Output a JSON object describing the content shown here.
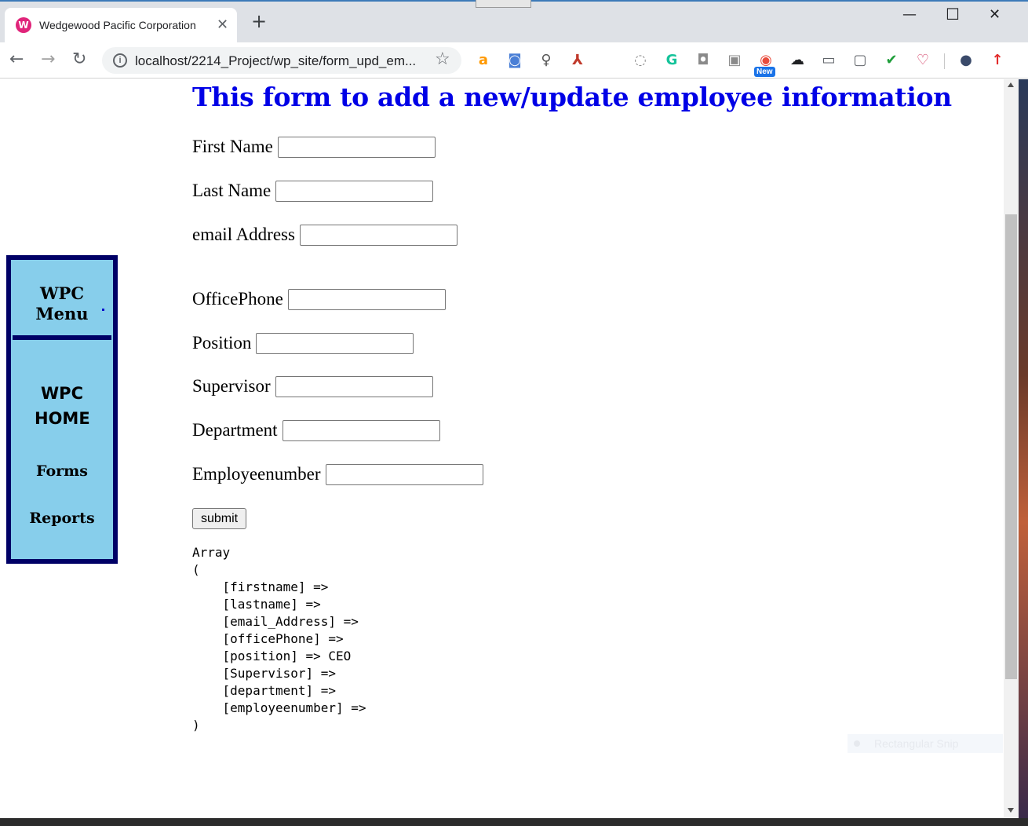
{
  "browser": {
    "tab_title": "Wedgewood Pacific Corporation",
    "tab_favicon": "W",
    "tab_close": "✕",
    "new_tab": "+",
    "url": "localhost/2214_Project/wp_site/form_upd_em...",
    "omnibox_info": "i",
    "bookmark_star": "☆",
    "nav_back": "←",
    "nav_forward": "→",
    "nav_reload": "↻",
    "window_minimize": "—",
    "window_maximize": "☐",
    "window_close": "✕",
    "extension_new_badge": "New",
    "extensions": [
      {
        "icon": "amazon-icon",
        "glyph": "a",
        "color": "#ff9900"
      },
      {
        "icon": "camera-icon",
        "glyph": "◙",
        "color": "#4a7fd6"
      },
      {
        "icon": "lightbulb-icon",
        "glyph": "♀",
        "color": "#555555"
      },
      {
        "icon": "acrobat-icon",
        "glyph": "⅄",
        "color": "#c0392b"
      },
      {
        "icon": "ellipsis-circle-icon",
        "glyph": "◌",
        "color": "#8a8a8a"
      },
      {
        "icon": "grammarly-icon",
        "glyph": "G",
        "color": "#15c39a"
      },
      {
        "icon": "screenshot-camera-icon",
        "glyph": "◘",
        "color": "#8a8a8a"
      },
      {
        "icon": "puzzle-icon",
        "glyph": "▣",
        "color": "#8a8a8a"
      },
      {
        "icon": "colorful-extension-icon",
        "glyph": "◉",
        "color": "#e84c3d"
      },
      {
        "icon": "cloud-icon",
        "glyph": "☁",
        "color": "#202124"
      },
      {
        "icon": "cast-icon",
        "glyph": "▭",
        "color": "#5f6368"
      },
      {
        "icon": "capture-frame-icon",
        "glyph": "▢",
        "color": "#5f6368"
      },
      {
        "icon": "checkmark-icon",
        "glyph": "✔",
        "color": "#1e9e3a"
      },
      {
        "icon": "pocket-icon",
        "glyph": "♡",
        "color": "#d0315a"
      },
      {
        "icon": "profile-avatar-icon",
        "glyph": "●",
        "color": "#3a4a6a"
      },
      {
        "icon": "update-arrow-icon",
        "glyph": "↑",
        "color": "#e22b2b"
      }
    ]
  },
  "sidenav": {
    "title": "WPC Menu",
    "home": "WPC HOME",
    "forms": "Forms",
    "reports": "Reports"
  },
  "form": {
    "heading": "This form to add a new/update employee information",
    "fields": [
      {
        "label": "First Name",
        "value": ""
      },
      {
        "label": "Last Name",
        "value": ""
      },
      {
        "label": "email Address",
        "value": ""
      },
      {
        "label": "OfficePhone",
        "value": ""
      },
      {
        "label": "Position",
        "value": ""
      },
      {
        "label": "Supervisor",
        "value": ""
      },
      {
        "label": "Department",
        "value": ""
      },
      {
        "label": "Employeenumber",
        "value": ""
      }
    ],
    "submit_label": "submit"
  },
  "array_dump": "Array\n(\n    [firstname] => \n    [lastname] => \n    [email_Address] => \n    [officePhone] => \n    [position] => CEO\n    [Supervisor] => \n    [department] => \n    [employeenumber] => \n)",
  "snip_overlay_text": "Rectangular Snip",
  "colors": {
    "heading": "#0000e6",
    "sidenav_bg": "#87ceeb",
    "sidenav_border": "#000066"
  }
}
